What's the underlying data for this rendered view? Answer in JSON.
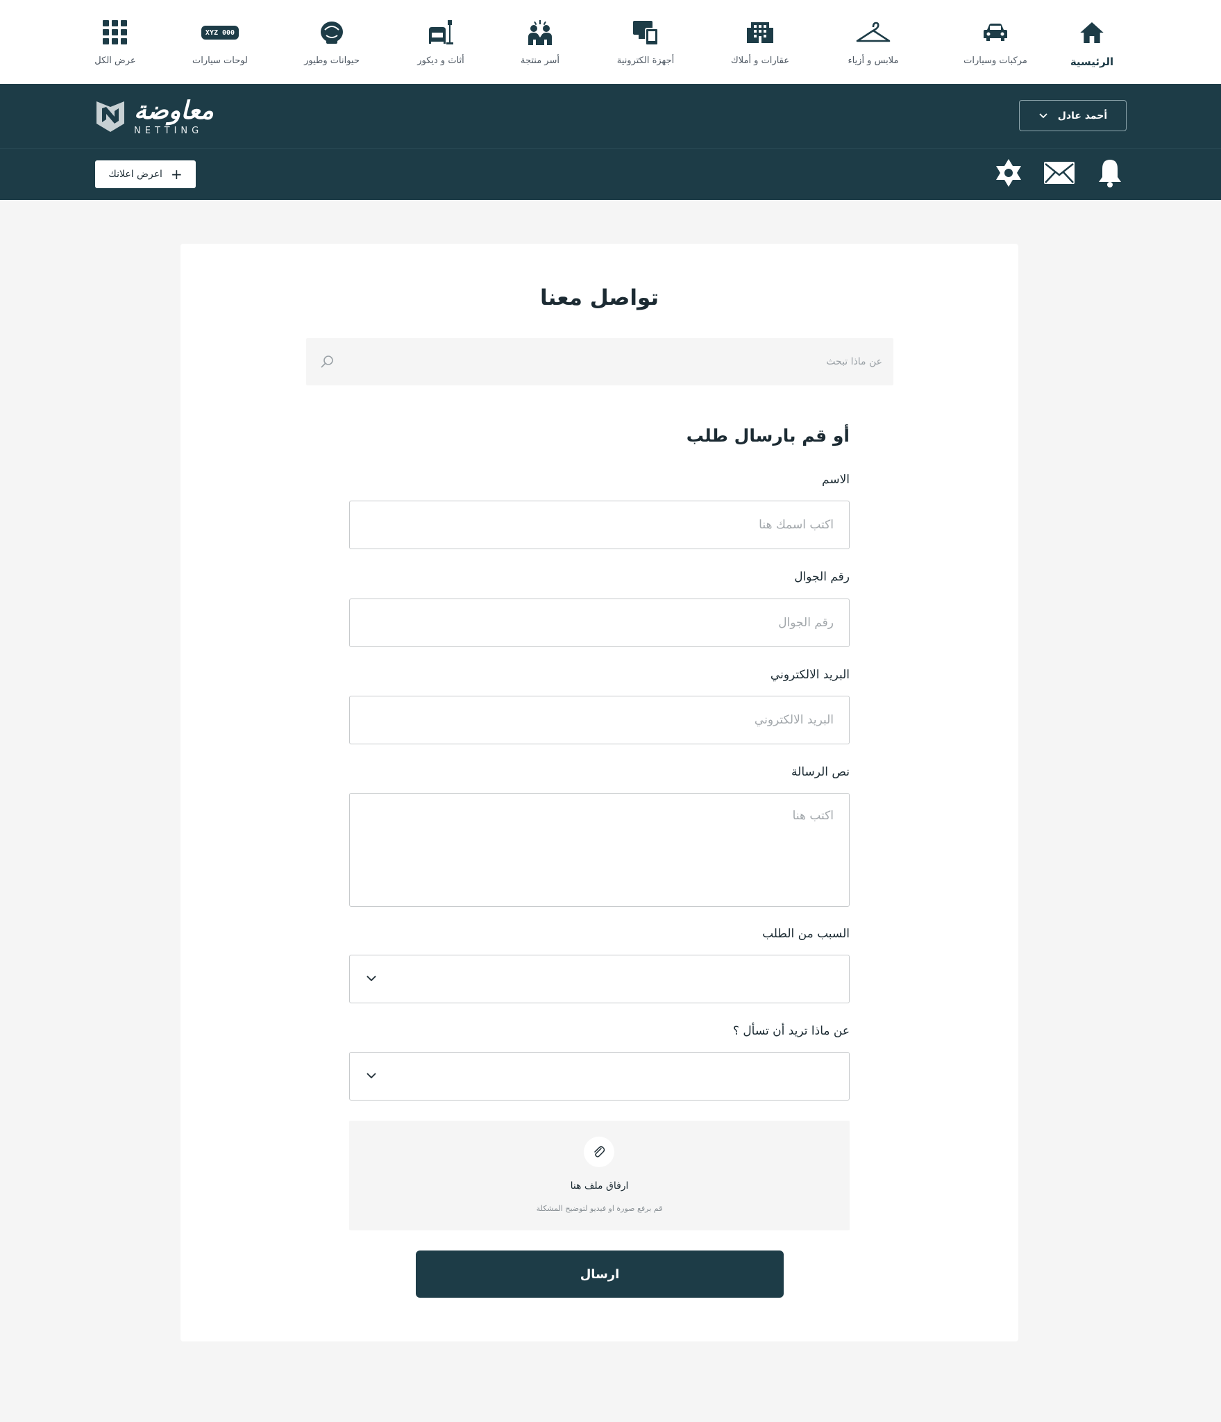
{
  "categories": [
    {
      "label": "الرئيسية",
      "icon": "home-icon",
      "active": true
    },
    {
      "label": "مركبات وسيارات",
      "icon": "car-icon"
    },
    {
      "label": "ملابس و أزياء",
      "icon": "hanger-icon"
    },
    {
      "label": "عقارات و أملاك",
      "icon": "building-icon"
    },
    {
      "label": "أجهزة الكترونية",
      "icon": "devices-icon"
    },
    {
      "label": "أسر منتجة",
      "icon": "family-icon"
    },
    {
      "label": "أثاث و ديكور",
      "icon": "furniture-icon"
    },
    {
      "label": "حيوانات وطيور",
      "icon": "pets-icon"
    },
    {
      "label": "لوحات سيارات",
      "icon": "license-plate-icon",
      "plate_text": "XYZ 000"
    },
    {
      "label": "عرض الكل",
      "icon": "grid-icon"
    }
  ],
  "header": {
    "logo_ar": "معاوضة",
    "logo_en": "NETTING",
    "user_name": "أحمد عادل",
    "add_ad_label": "اعرض اعلانك",
    "add_ad_plus": "+"
  },
  "page": {
    "title": "تواصل معنا",
    "search_placeholder": "عن ماذا تبحث",
    "form_title": "أو قم بارسال طلب",
    "fields": {
      "name_label": "الاسم",
      "name_placeholder": "اكتب اسمك هنا",
      "phone_label": "رقم الجوال",
      "phone_placeholder": "رقم الجوال",
      "email_label": "البريد الالكتروني",
      "email_placeholder": "البريد الالكتروني",
      "message_label": "نص الرسالة",
      "message_placeholder": "اكتب هنا",
      "reason_label": "السبب من الطلب",
      "topic_label": "عن ماذا تريد أن تسأل ؟"
    },
    "upload": {
      "title": "ارفاق ملف هنا",
      "subtitle": "قم برفع صورة او فيديو لتوضيح المشكلة"
    },
    "submit_label": "ارسال"
  },
  "colors": {
    "primary": "#1d3c47",
    "background": "#f5f5f5",
    "card": "#ffffff"
  }
}
